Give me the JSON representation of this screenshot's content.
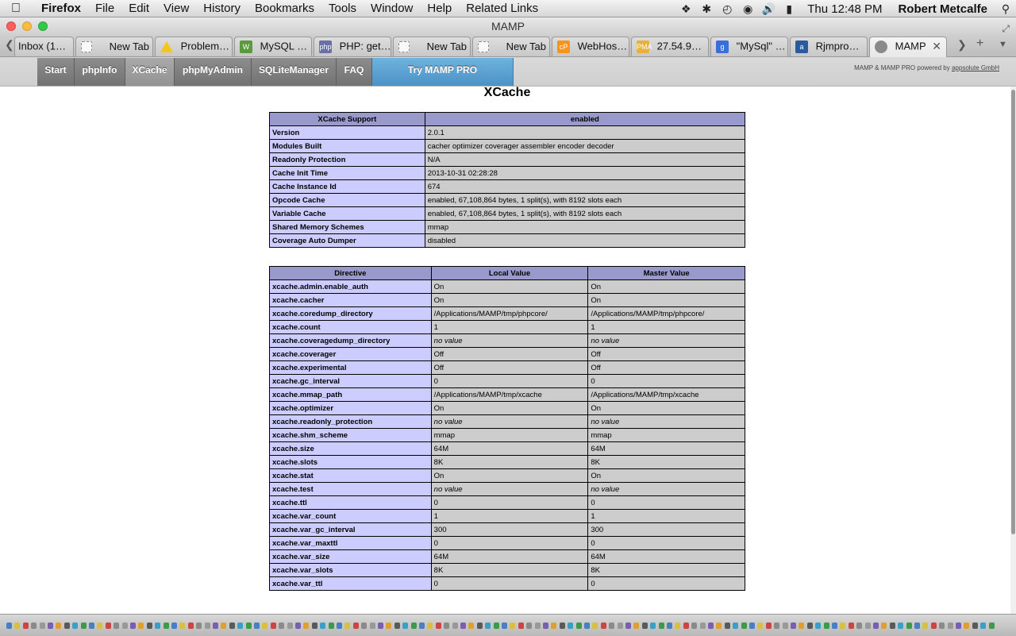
{
  "menubar": {
    "app": "Firefox",
    "items": [
      "File",
      "Edit",
      "View",
      "History",
      "Bookmarks",
      "Tools",
      "Window",
      "Help",
      "Related Links"
    ],
    "clock": "Thu 12:48 PM",
    "user": "Robert Metcalfe"
  },
  "window": {
    "title": "MAMP"
  },
  "tabs": [
    {
      "label": "Inbox (1…",
      "icon": "none"
    },
    {
      "label": "New Tab",
      "icon": "blank-page-icon"
    },
    {
      "label": "Problem…",
      "icon": "warning-icon"
    },
    {
      "label": "MySQL …",
      "icon": "mysql-icon"
    },
    {
      "label": "PHP: get…",
      "icon": "php-icon"
    },
    {
      "label": "New Tab",
      "icon": "blank-page-icon"
    },
    {
      "label": "New Tab",
      "icon": "blank-page-icon"
    },
    {
      "label": "WebHos…",
      "icon": "cpanel-icon"
    },
    {
      "label": "27.54.9…",
      "icon": "phpmyadmin-icon"
    },
    {
      "label": "\"MySql\" …",
      "icon": "google-icon"
    },
    {
      "label": "Rjmpro…",
      "icon": "site-icon"
    },
    {
      "label": "MAMP",
      "icon": "globe-icon"
    }
  ],
  "nav": {
    "items": [
      "Start",
      "phpInfo",
      "XCache",
      "phpMyAdmin",
      "SQLiteManager",
      "FAQ"
    ],
    "pro": "Try MAMP PRO",
    "powered_text": "MAMP & MAMP PRO powered by",
    "powered_link": "appsolute GmbH"
  },
  "page": {
    "title": "XCache"
  },
  "support_table": {
    "header": [
      "XCache Support",
      "enabled"
    ],
    "rows": [
      [
        "Version",
        "2.0.1"
      ],
      [
        "Modules Built",
        "cacher optimizer coverager assembler encoder decoder"
      ],
      [
        "Readonly Protection",
        "N/A"
      ],
      [
        "Cache Init Time",
        "2013-10-31 02:28:28"
      ],
      [
        "Cache Instance Id",
        "674"
      ],
      [
        "Opcode Cache",
        "enabled, 67,108,864 bytes, 1 split(s), with 8192 slots each"
      ],
      [
        "Variable Cache",
        "enabled, 67,108,864 bytes, 1 split(s), with 8192 slots each"
      ],
      [
        "Shared Memory Schemes",
        "mmap"
      ],
      [
        "Coverage Auto Dumper",
        "disabled"
      ]
    ]
  },
  "directive_table": {
    "header": [
      "Directive",
      "Local Value",
      "Master Value"
    ],
    "rows": [
      [
        "xcache.admin.enable_auth",
        "On",
        "On"
      ],
      [
        "xcache.cacher",
        "On",
        "On"
      ],
      [
        "xcache.coredump_directory",
        "/Applications/MAMP/tmp/phpcore/",
        "/Applications/MAMP/tmp/phpcore/"
      ],
      [
        "xcache.count",
        "1",
        "1"
      ],
      [
        "xcache.coveragedump_directory",
        "no value",
        "no value"
      ],
      [
        "xcache.coverager",
        "Off",
        "Off"
      ],
      [
        "xcache.experimental",
        "Off",
        "Off"
      ],
      [
        "xcache.gc_interval",
        "0",
        "0"
      ],
      [
        "xcache.mmap_path",
        "/Applications/MAMP/tmp/xcache",
        "/Applications/MAMP/tmp/xcache"
      ],
      [
        "xcache.optimizer",
        "On",
        "On"
      ],
      [
        "xcache.readonly_protection",
        "no value",
        "no value"
      ],
      [
        "xcache.shm_scheme",
        "mmap",
        "mmap"
      ],
      [
        "xcache.size",
        "64M",
        "64M"
      ],
      [
        "xcache.slots",
        "8K",
        "8K"
      ],
      [
        "xcache.stat",
        "On",
        "On"
      ],
      [
        "xcache.test",
        "no value",
        "no value"
      ],
      [
        "xcache.ttl",
        "0",
        "0"
      ],
      [
        "xcache.var_count",
        "1",
        "1"
      ],
      [
        "xcache.var_gc_interval",
        "300",
        "300"
      ],
      [
        "xcache.var_maxttl",
        "0",
        "0"
      ],
      [
        "xcache.var_size",
        "64M",
        "64M"
      ],
      [
        "xcache.var_slots",
        "8K",
        "8K"
      ],
      [
        "xcache.var_ttl",
        "0",
        "0"
      ]
    ]
  },
  "colors": {
    "header_bg": "#9999cc",
    "key_bg": "#ccccff",
    "value_bg": "#cccccc",
    "pro_button": "#4a93c6"
  }
}
